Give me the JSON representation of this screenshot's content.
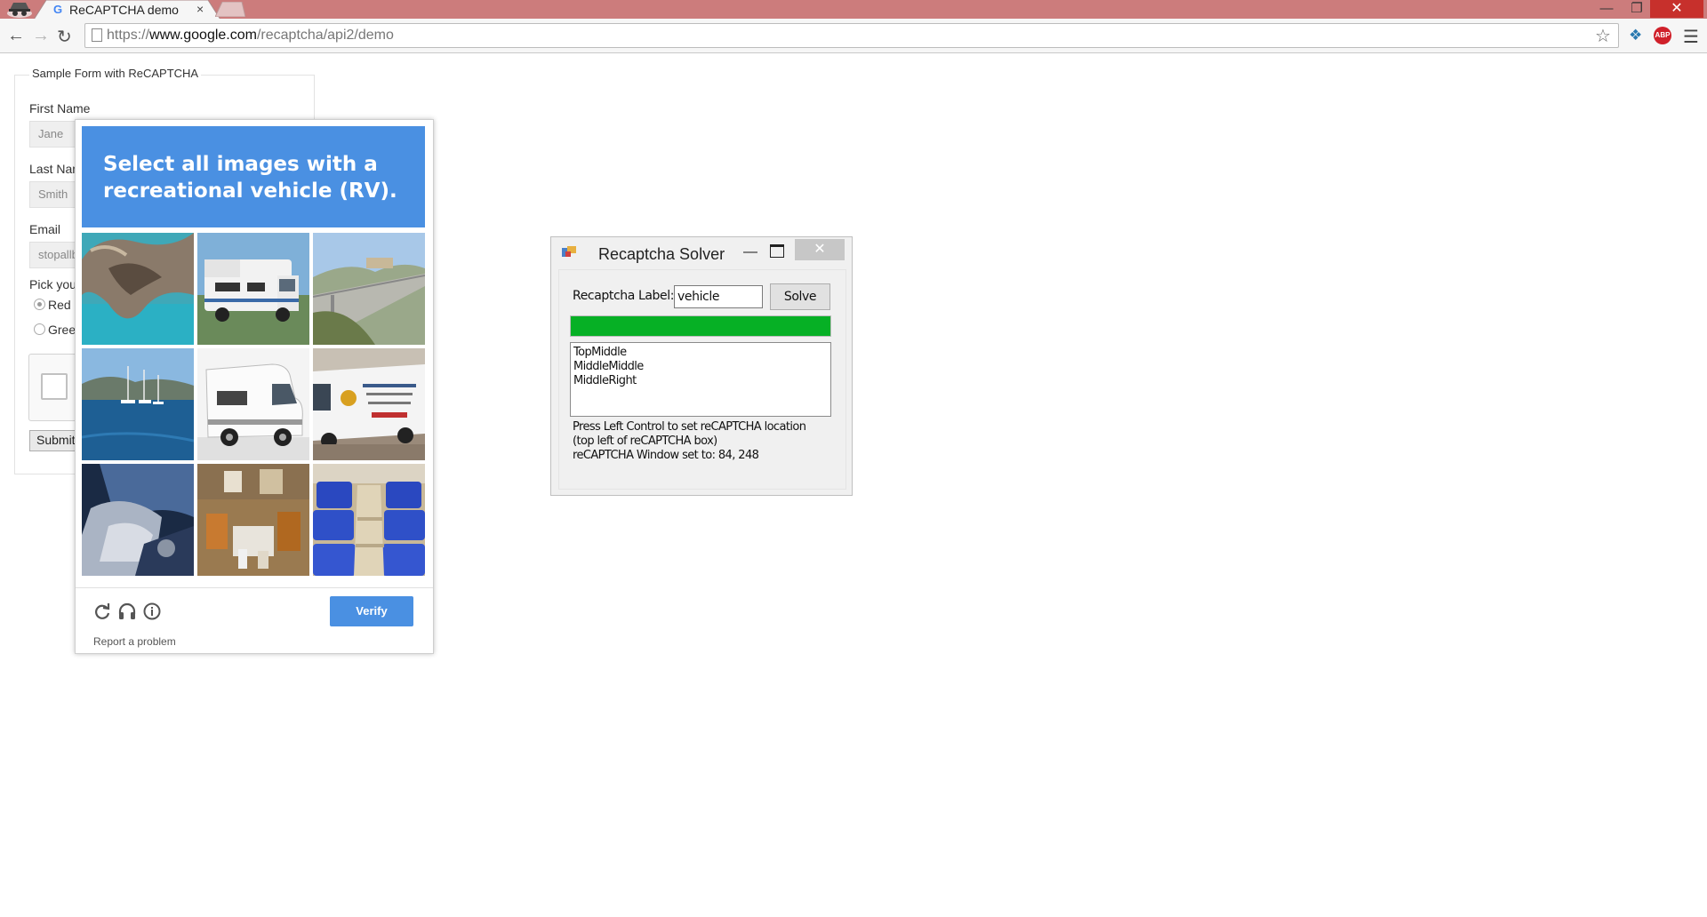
{
  "browser": {
    "tab_title": "ReCAPTCHA demo",
    "tab_close": "×",
    "url_scheme": "https://",
    "url_host": "www.google.com",
    "url_path": "/recaptcha/api2/demo",
    "window_min": "—",
    "window_restore": "❐",
    "window_close": "✕",
    "icons": [
      "incognito-icon",
      "google-favicon",
      "back-icon",
      "forward-icon",
      "reload-icon",
      "page-icon",
      "star-icon",
      "extension-icon",
      "adblock-plus-icon",
      "menu-icon"
    ],
    "abp_text": "ABP",
    "colors": {
      "titlebar": "#cc7c7c",
      "close": "#c7302c"
    }
  },
  "form": {
    "legend": "Sample Form with ReCAPTCHA",
    "first_name_label": "First Name",
    "first_name_value": "Jane",
    "last_name_label": "Last Name",
    "last_name_value": "Smith",
    "email_label": "Email",
    "email_value": "stopallbots@gmail.com",
    "color_label": "Pick your favorite color:",
    "radio_red": "Red",
    "radio_green": "Green",
    "submit": "Submit"
  },
  "challenge": {
    "instruction_line1": "Select all images with a",
    "instruction_line2": "recreational vehicle (RV).",
    "tiles": [
      {
        "name": "sea-rock-arch",
        "selected": false
      },
      {
        "name": "motorhome",
        "selected": false
      },
      {
        "name": "bridge-landscape",
        "selected": false
      },
      {
        "name": "harbor-boats",
        "selected": false
      },
      {
        "name": "white-camper",
        "selected": false
      },
      {
        "name": "commercial-van",
        "selected": false
      },
      {
        "name": "car-interior",
        "selected": false
      },
      {
        "name": "room-interior",
        "selected": false
      },
      {
        "name": "bus-seats",
        "selected": false
      }
    ],
    "verify": "Verify",
    "report": "Report a problem",
    "colors": {
      "header": "#4a90e2",
      "verify": "#4a90e2"
    }
  },
  "solver": {
    "title": "Recaptcha Solver",
    "label": "Recaptcha Label:",
    "input_value": "vehicle",
    "solve_button": "Solve",
    "progress_fraction": 1.0,
    "results": [
      "TopMiddle",
      "MiddleMiddle",
      "MiddleRight"
    ],
    "info": [
      "Press Left Control to set reCAPTCHA location",
      "(top left of reCAPTCHA box)",
      "reCAPTCHA Window set to: 84, 248"
    ],
    "minimize": "—",
    "close": "✕",
    "colors": {
      "progress": "#06b025"
    }
  }
}
